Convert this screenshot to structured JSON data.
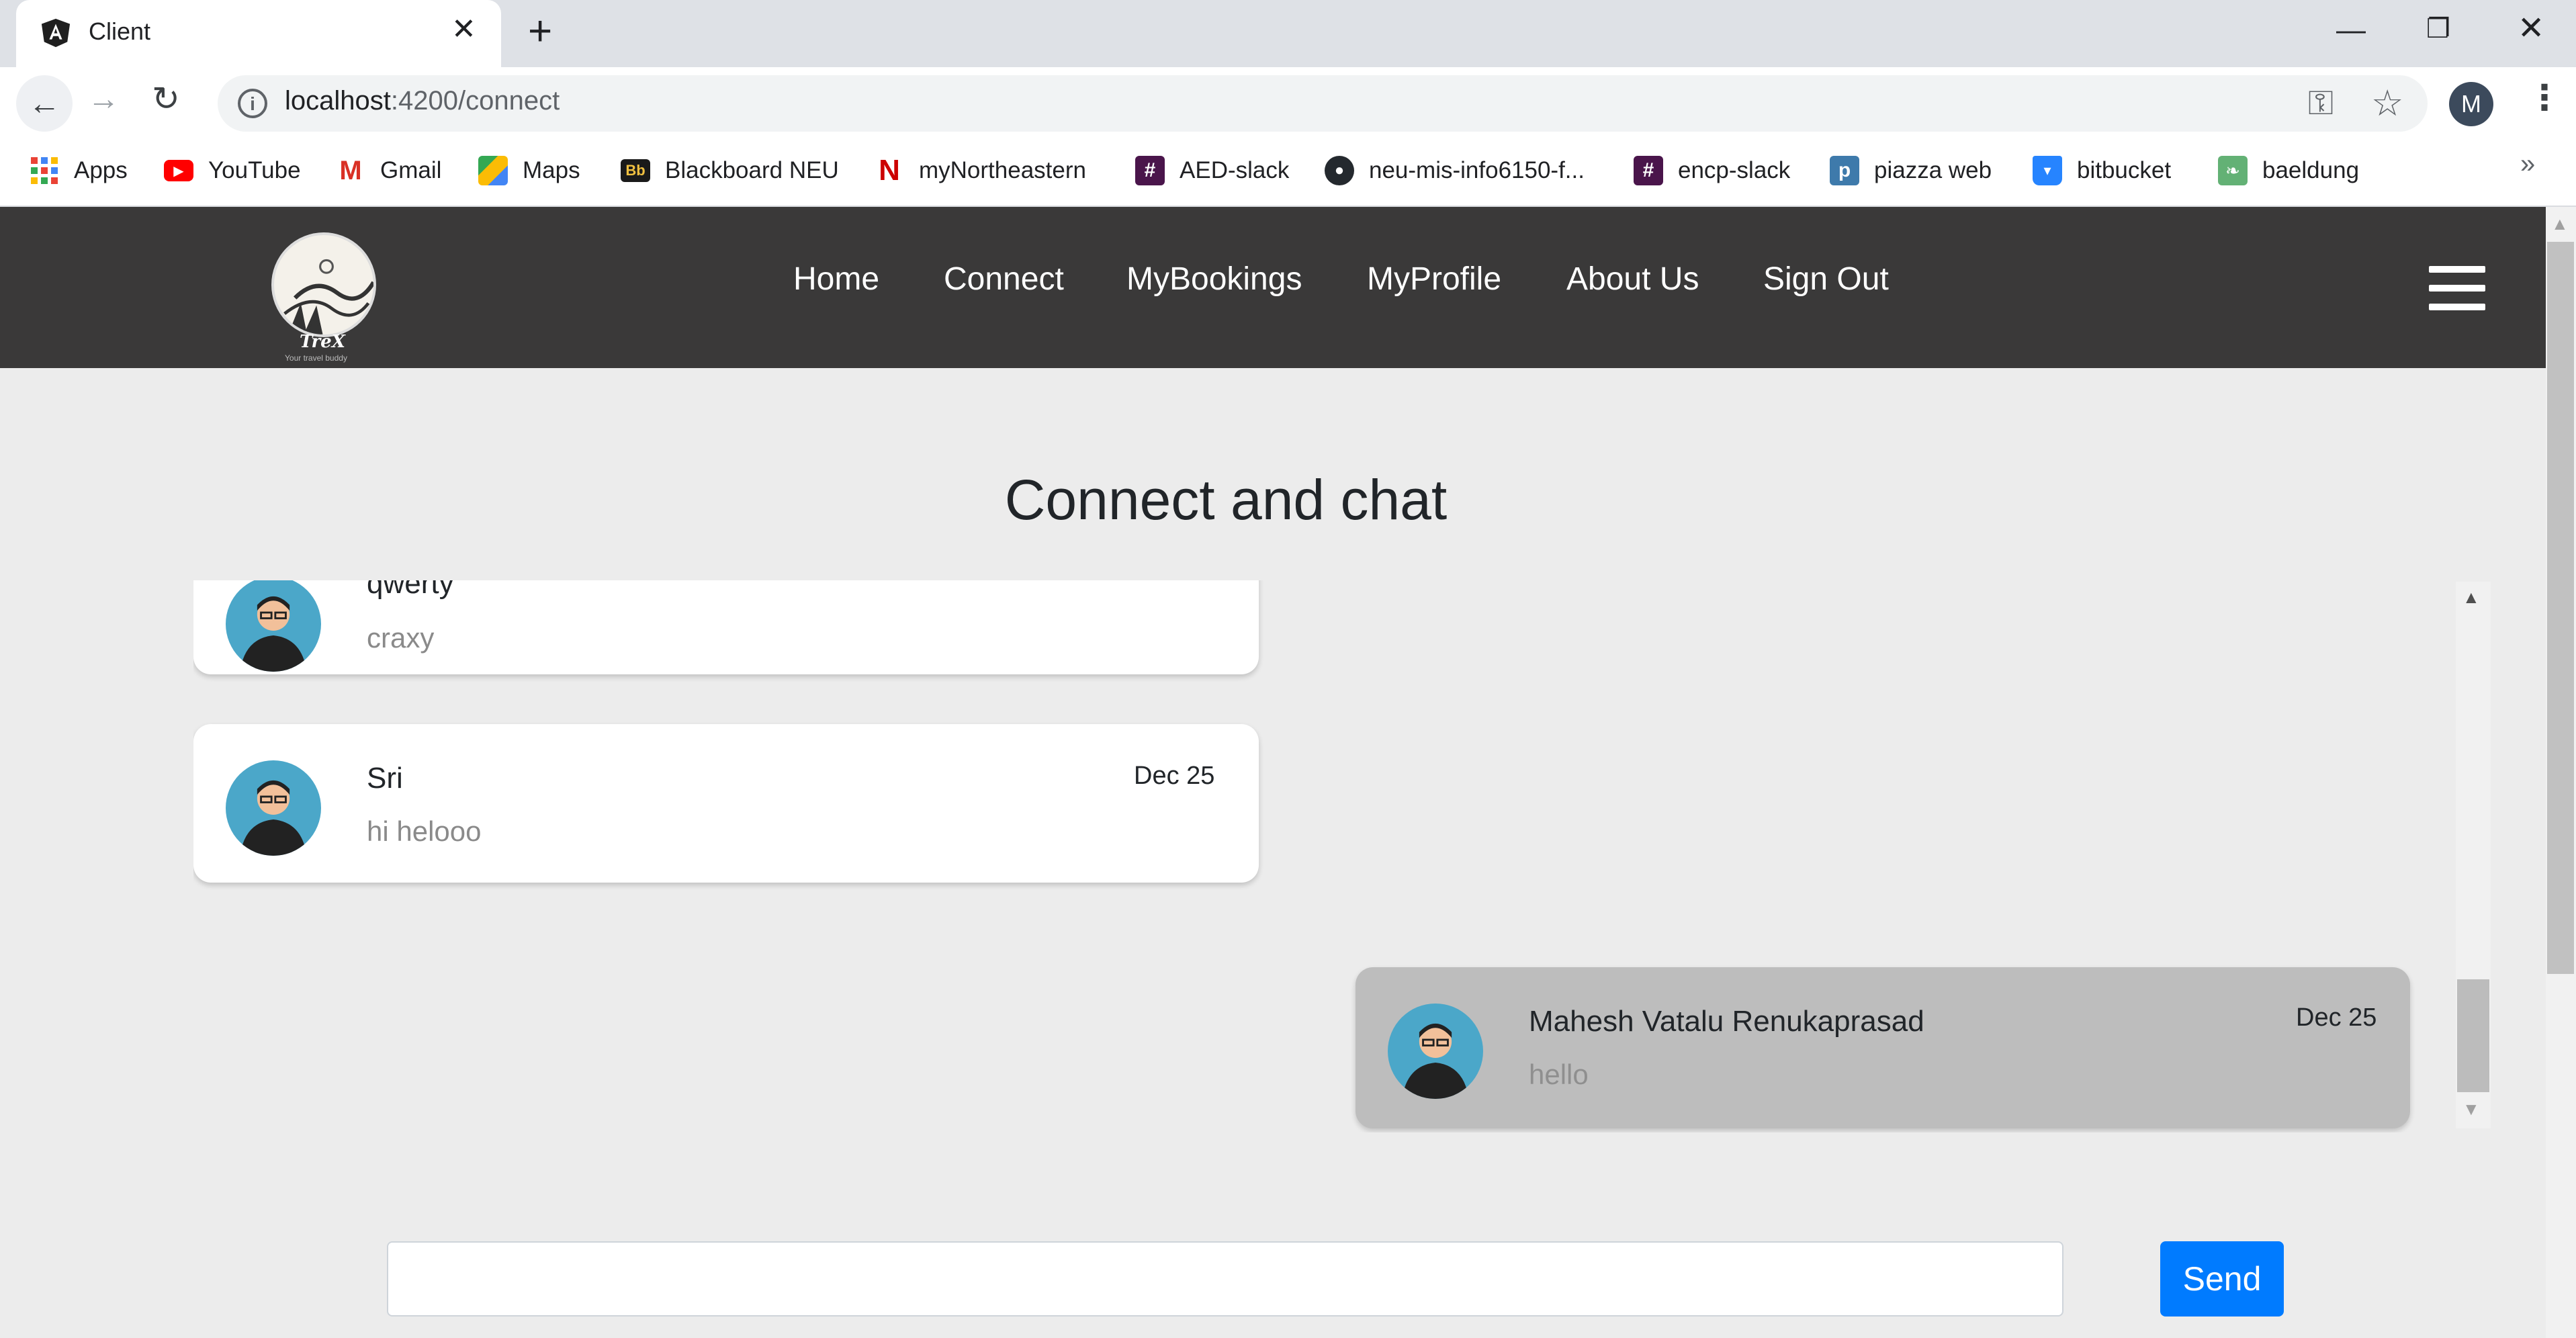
{
  "browser": {
    "tab_title": "Client",
    "tab_close": "✕",
    "new_tab": "+",
    "url_host": "localhost",
    "url_path": ":4200/connect",
    "profile_initial": "M",
    "window_controls": {
      "minimize": "—",
      "maximize": "❐",
      "close": "✕"
    },
    "bookmarks": [
      {
        "label": "Apps",
        "icon": "apps-grid-icon"
      },
      {
        "label": "YouTube",
        "icon": "youtube-icon"
      },
      {
        "label": "Gmail",
        "icon": "gmail-icon"
      },
      {
        "label": "Maps",
        "icon": "maps-icon"
      },
      {
        "label": "Blackboard NEU",
        "icon": "blackboard-icon"
      },
      {
        "label": "myNortheastern",
        "icon": "northeastern-icon"
      },
      {
        "label": "AED-slack",
        "icon": "slack-icon"
      },
      {
        "label": "neu-mis-info6150-f...",
        "icon": "github-icon"
      },
      {
        "label": "encp-slack",
        "icon": "slack-icon"
      },
      {
        "label": "piazza web",
        "icon": "piazza-icon"
      },
      {
        "label": "bitbucket",
        "icon": "bitbucket-icon"
      },
      {
        "label": "baeldung",
        "icon": "baeldung-icon"
      }
    ],
    "bookmarks_more": "»"
  },
  "app": {
    "logo_text": "TreX",
    "logo_tagline": "Your travel buddy",
    "nav": [
      "Home",
      "Connect",
      "MyBookings",
      "MyProfile",
      "About Us",
      "Sign Out"
    ],
    "page_title": "Connect and chat"
  },
  "messages": [
    {
      "name": "qwerty",
      "text": "craxy",
      "date": "",
      "mine": false
    },
    {
      "name": "Sri",
      "text": "hi helooo",
      "date": "Dec 25",
      "mine": false
    },
    {
      "name": "Mahesh Vatalu Renukaprasad",
      "text": "hello",
      "date": "Dec 25",
      "mine": true
    }
  ],
  "composer": {
    "value": "",
    "send_label": "Send"
  },
  "colors": {
    "navbar_bg": "#3a3939",
    "page_bg": "#ececec",
    "send_button": "#007bff",
    "own_message_bg": "#bdbdbd",
    "other_message_bg": "#ffffff"
  }
}
